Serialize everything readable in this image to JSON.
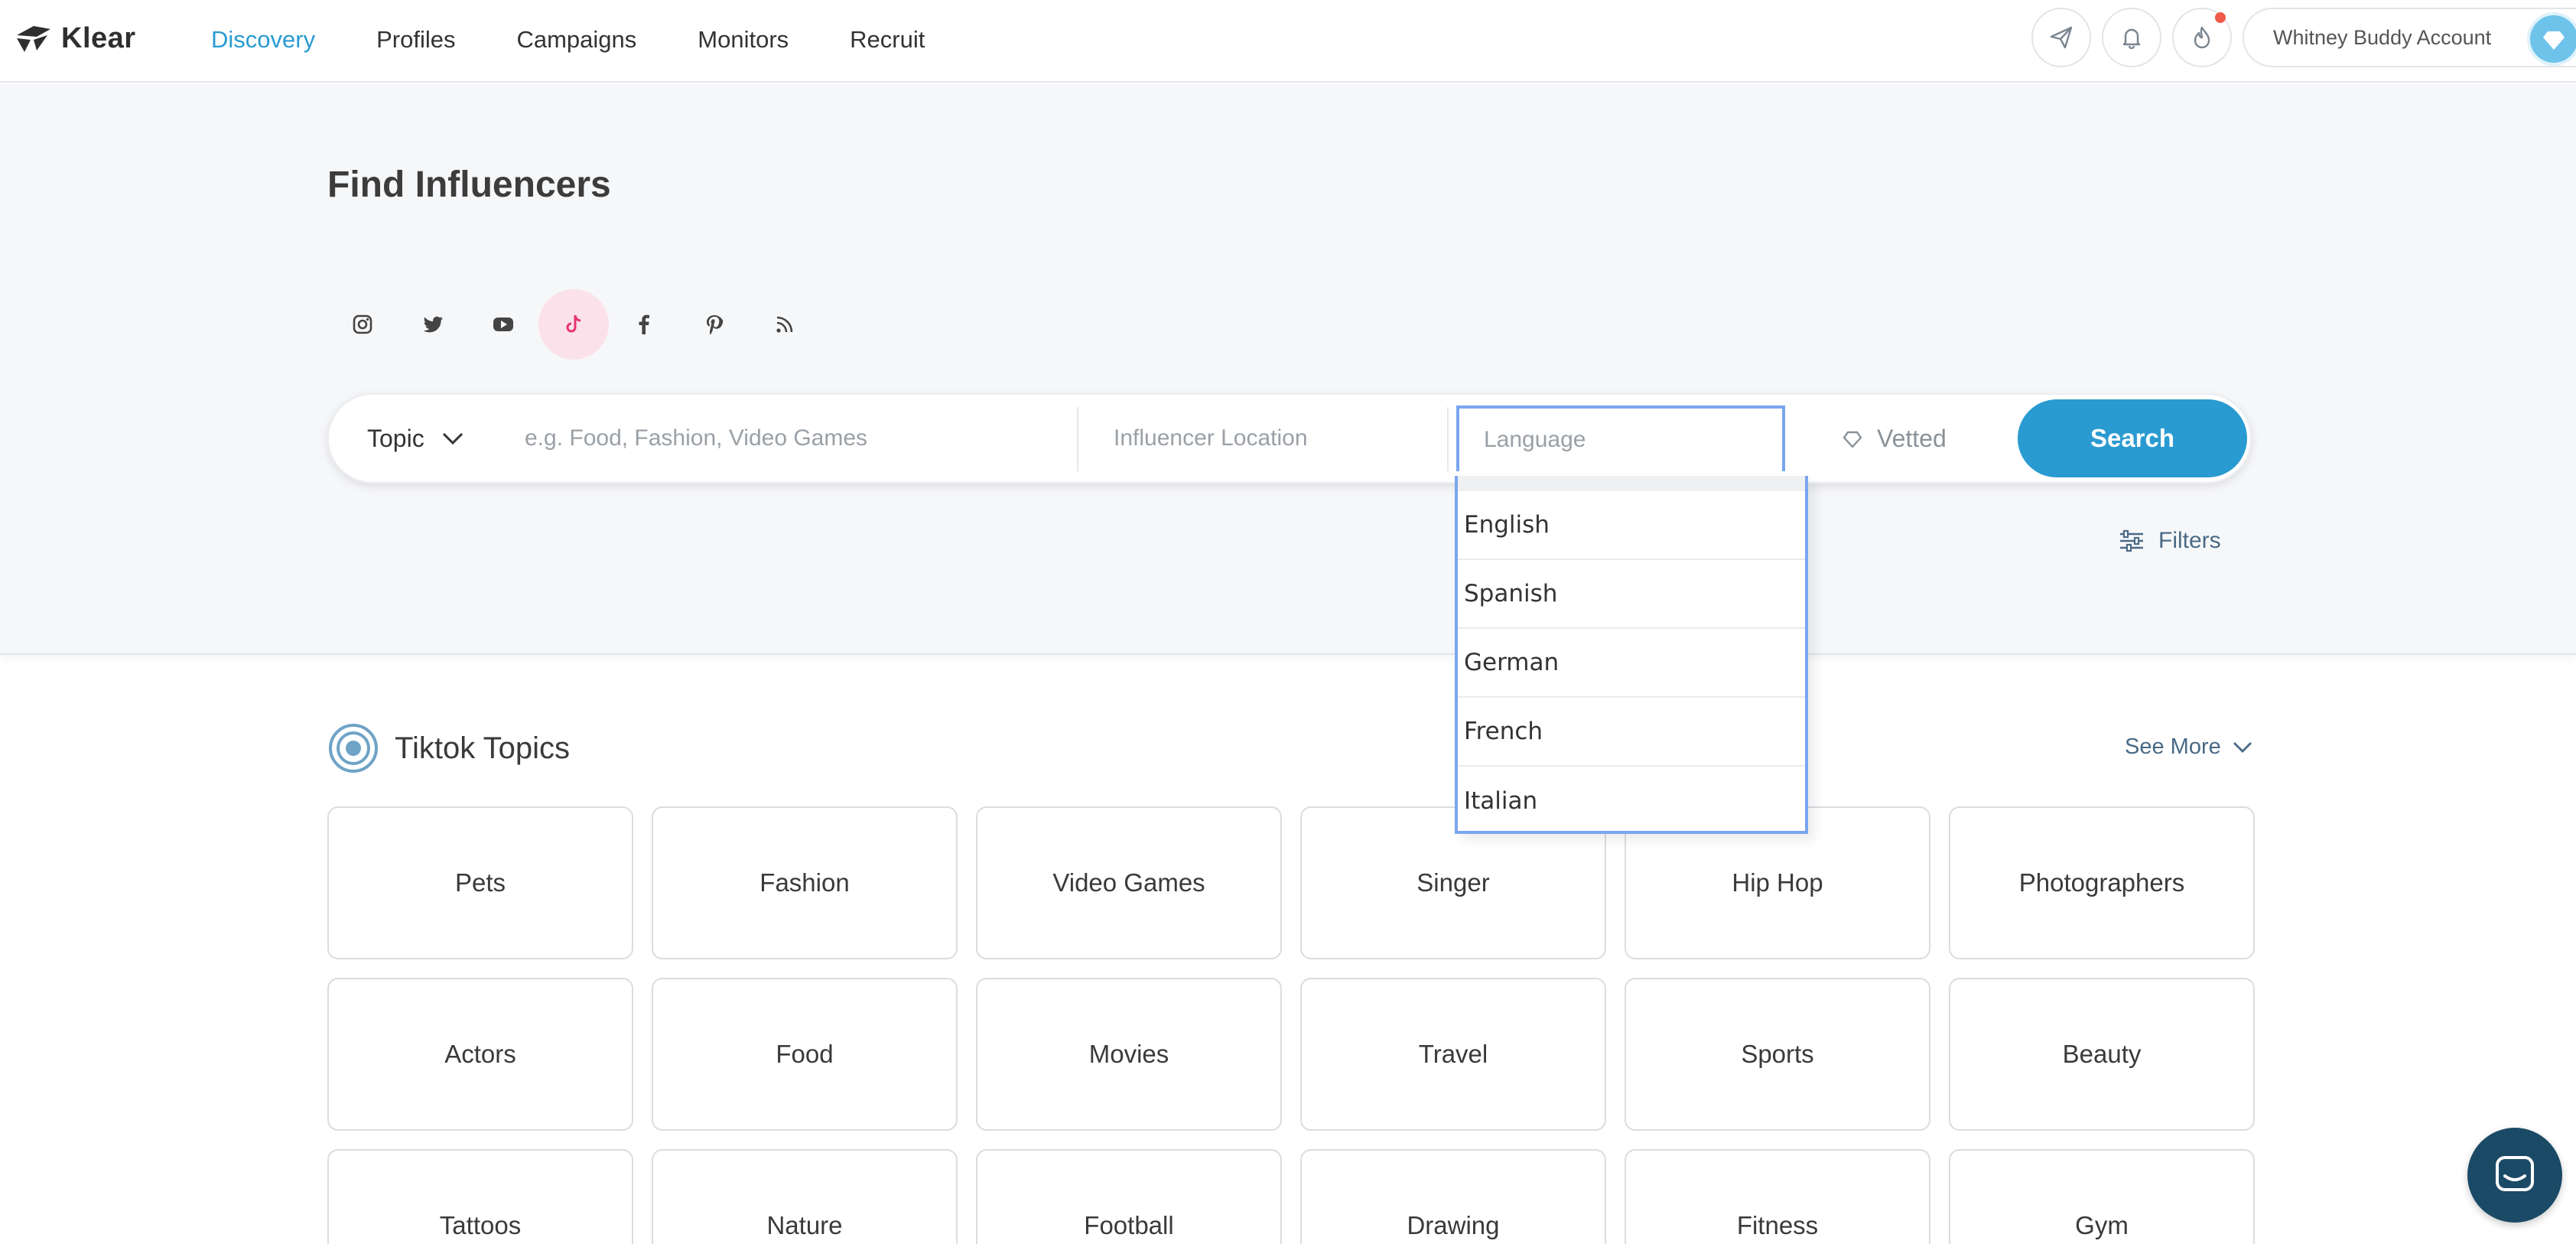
{
  "app": {
    "name": "Klear"
  },
  "nav": {
    "items": [
      {
        "label": "Discovery",
        "active": true
      },
      {
        "label": "Profiles"
      },
      {
        "label": "Campaigns"
      },
      {
        "label": "Monitors"
      },
      {
        "label": "Recruit"
      }
    ]
  },
  "header_actions": {
    "icons": [
      "send-icon",
      "bell-icon",
      "flame-icon"
    ],
    "account_label": "Whitney Buddy Account"
  },
  "page": {
    "title": "Find Influencers"
  },
  "platforms": [
    {
      "icon": "instagram-icon"
    },
    {
      "icon": "twitter-icon"
    },
    {
      "icon": "youtube-icon"
    },
    {
      "icon": "tiktok-icon",
      "active": true
    },
    {
      "icon": "facebook-icon"
    },
    {
      "icon": "pinterest-icon"
    },
    {
      "icon": "rss-icon"
    }
  ],
  "search": {
    "topic_label": "Topic",
    "topic_placeholder": "e.g. Food, Fashion, Video Games",
    "location_placeholder": "Influencer Location",
    "language_placeholder": "Language",
    "vetted_label": "Vetted",
    "button_label": "Search",
    "filters_label": "Filters"
  },
  "language_dropdown": {
    "options": [
      "English",
      "Spanish",
      "German",
      "French",
      "Italian"
    ]
  },
  "topics": {
    "title": "Tiktok Topics",
    "see_more": "See More",
    "items": [
      "Pets",
      "Fashion",
      "Video Games",
      "Singer",
      "Hip Hop",
      "Photographers",
      "Actors",
      "Food",
      "Movies",
      "Travel",
      "Sports",
      "Beauty",
      "Tattoos",
      "Nature",
      "Football",
      "Drawing",
      "Fitness",
      "Gym"
    ]
  },
  "colors": {
    "accent": "#2a9bd1",
    "tiktok_active_bg": "#fbe1ea",
    "tiktok_active_fg": "#e8336e",
    "focus_border": "#7aa6f0",
    "chat_bg": "#1b4a66"
  }
}
